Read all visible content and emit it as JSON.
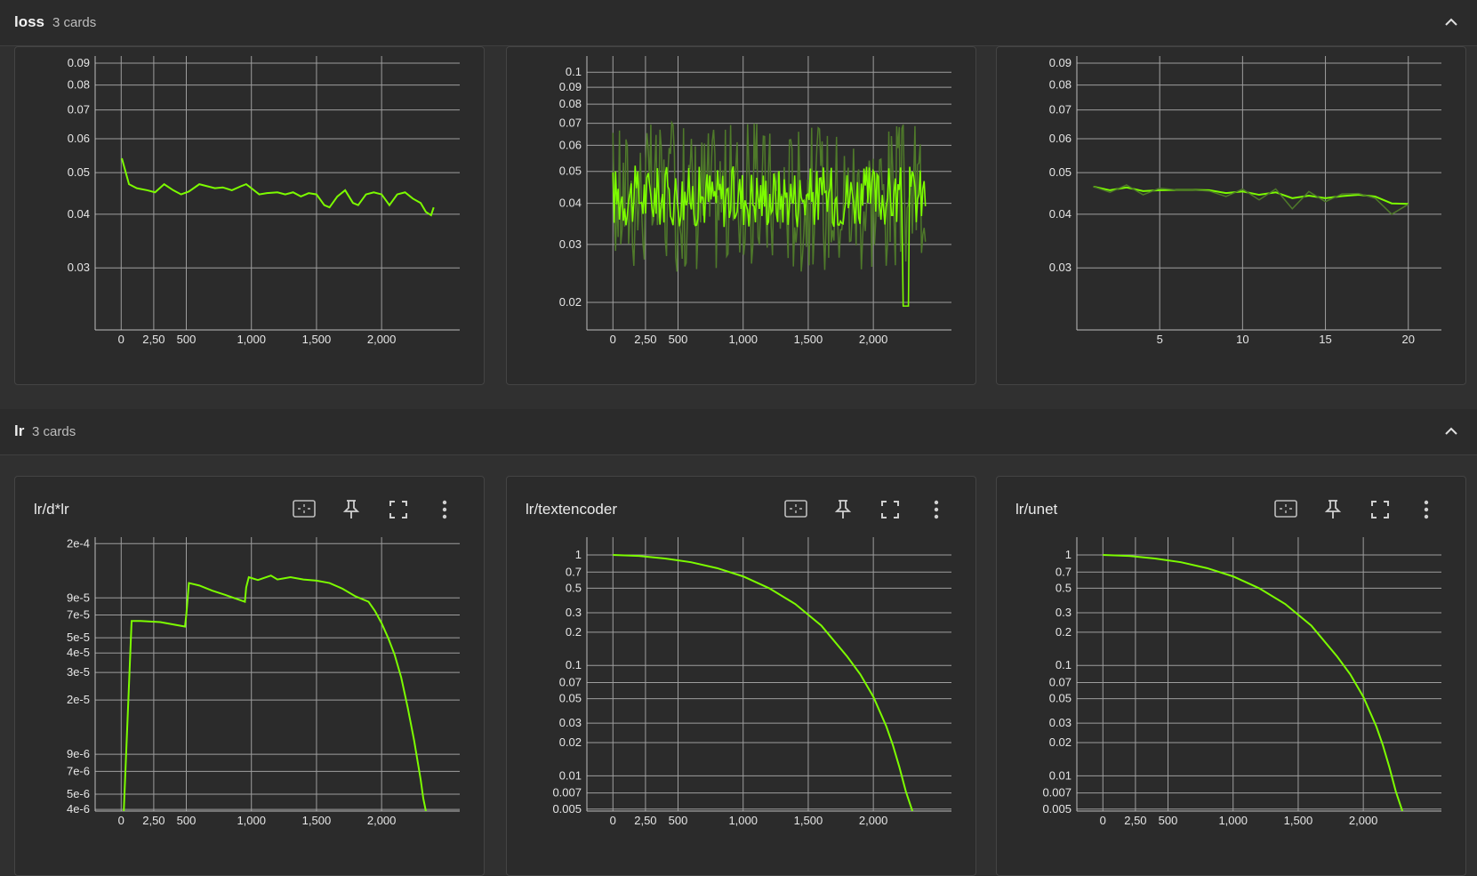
{
  "sections": [
    {
      "title": "loss",
      "count": "3 cards"
    },
    {
      "title": "lr",
      "count": "3 cards"
    }
  ],
  "icons": {
    "collapse": "chevron-up-icon",
    "fit": "fit-domain-icon",
    "pin": "pin-icon",
    "fullscreen": "fullscreen-icon",
    "more": "more-vert-icon"
  },
  "colors": {
    "series": "#7cfc00",
    "series_raw": "#4f7a2a",
    "grid": "#9e9e9e"
  },
  "chart_data": [
    {
      "type": "line",
      "title": "",
      "y_scale": "log",
      "x_ticks": [
        "0",
        "500",
        "1,000",
        "1,500",
        "2,000",
        "2,50"
      ],
      "y_ticks": [
        "0.03",
        "0.04",
        "0.05",
        "0.06",
        "0.07",
        "0.08",
        "0.09"
      ],
      "xlim": [
        -200,
        2600
      ],
      "ylim": [
        0.0215,
        0.0935
      ],
      "series": [
        {
          "x": [
            5,
            60,
            120,
            200,
            260,
            330,
            400,
            460,
            520,
            600,
            660,
            720,
            780,
            850,
            920,
            960,
            1000,
            1060,
            1120,
            1200,
            1260,
            1320,
            1380,
            1440,
            1500,
            1560,
            1600,
            1660,
            1720,
            1780,
            1820,
            1880,
            1940,
            2000,
            2060,
            2120,
            2180,
            2240,
            2300,
            2340,
            2380,
            2400
          ],
          "y": [
            0.054,
            0.047,
            0.046,
            0.0455,
            0.045,
            0.047,
            0.0455,
            0.0445,
            0.0452,
            0.047,
            0.0465,
            0.046,
            0.0462,
            0.0455,
            0.0465,
            0.047,
            0.046,
            0.0445,
            0.0448,
            0.045,
            0.0445,
            0.045,
            0.044,
            0.0448,
            0.0445,
            0.042,
            0.0415,
            0.044,
            0.0455,
            0.0425,
            0.042,
            0.0445,
            0.045,
            0.0445,
            0.042,
            0.0445,
            0.045,
            0.0435,
            0.0425,
            0.0405,
            0.0398,
            0.0415
          ]
        }
      ]
    },
    {
      "type": "line",
      "title": "",
      "y_scale": "log",
      "x_ticks": [
        "0",
        "500",
        "1,000",
        "1,500",
        "2,000",
        "2,50"
      ],
      "y_ticks": [
        "0.02",
        "0.03",
        "0.04",
        "0.05",
        "0.06",
        "0.07",
        "0.08",
        "0.09",
        "0.1"
      ],
      "xlim": [
        -200,
        2600
      ],
      "ylim": [
        0.0165,
        0.112
      ],
      "noisy": {
        "n": 240,
        "center": 0.042,
        "smooth_spread": 0.55,
        "raw_spread": 1.35,
        "dip_at": 2250,
        "dip_value": 0.0195
      },
      "series": []
    },
    {
      "type": "line",
      "title": "",
      "y_scale": "log",
      "x_ticks": [
        "5",
        "10",
        "15",
        "20"
      ],
      "x_tick_values": [
        5,
        10,
        15,
        20
      ],
      "y_ticks": [
        "0.03",
        "0.04",
        "0.05",
        "0.06",
        "0.07",
        "0.08",
        "0.09"
      ],
      "xlim": [
        0,
        22
      ],
      "ylim": [
        0.0215,
        0.0935
      ],
      "series": [
        {
          "x": [
            1,
            2,
            3,
            4,
            5,
            6,
            7,
            8,
            9,
            10,
            11,
            12,
            13,
            14,
            15,
            16,
            17,
            18,
            19,
            20
          ],
          "y": [
            0.0464,
            0.0455,
            0.0462,
            0.0453,
            0.0455,
            0.0456,
            0.0456,
            0.0455,
            0.0448,
            0.0452,
            0.0444,
            0.045,
            0.0436,
            0.0442,
            0.0436,
            0.0441,
            0.0444,
            0.044,
            0.0424,
            0.0423
          ]
        },
        {
          "raw": true,
          "x": [
            1,
            2,
            3,
            4,
            5,
            6,
            7,
            8,
            9,
            10,
            11,
            12,
            13,
            14,
            15,
            16,
            17,
            18,
            19,
            20
          ],
          "y": [
            0.0464,
            0.045,
            0.0468,
            0.0444,
            0.046,
            0.0456,
            0.0456,
            0.0453,
            0.044,
            0.0458,
            0.0432,
            0.0458,
            0.0412,
            0.0452,
            0.0428,
            0.0446,
            0.0447,
            0.0436,
            0.04,
            0.0422
          ]
        }
      ]
    },
    {
      "type": "line",
      "title": "lr/d*lr",
      "y_scale": "log",
      "x_ticks": [
        "0",
        "500",
        "1,000",
        "1,500",
        "2,000",
        "2,50"
      ],
      "y_ticks": [
        "4e-6",
        "5e-6",
        "7e-6",
        "9e-6",
        "2e-5",
        "3e-5",
        "4e-5",
        "5e-5",
        "7e-5",
        "9e-5",
        "2e-4"
      ],
      "xlim": [
        -200,
        2600
      ],
      "ylim": [
        3.9e-06,
        0.00022
      ],
      "series": [
        {
          "x": [
            20,
            80,
            150,
            300,
            490,
            500,
            520,
            600,
            700,
            800,
            950,
            960,
            980,
            1050,
            1150,
            1200,
            1300,
            1400,
            1500,
            1600,
            1700,
            1800,
            1900,
            1950,
            2000,
            2050,
            2100,
            2150,
            2200,
            2250,
            2300,
            2320,
            2340
          ],
          "y": [
            3.9e-06,
            6.4e-05,
            6.4e-05,
            6.3e-05,
            5.9e-05,
            7e-05,
            0.000112,
            0.000108,
            0.0001,
            9.4e-05,
            8.5e-05,
            0.000105,
            0.000122,
            0.000117,
            0.000125,
            0.000118,
            0.000122,
            0.000118,
            0.000116,
            0.000112,
            0.000103,
            9.2e-05,
            8.5e-05,
            7.4e-05,
            6.2e-05,
            5e-05,
            3.9e-05,
            2.8e-05,
            1.8e-05,
            1.1e-05,
            6.2e-06,
            4.7e-06,
            3.9e-06
          ]
        }
      ]
    },
    {
      "type": "line",
      "title": "lr/textencoder",
      "y_scale": "log",
      "x_ticks": [
        "0",
        "500",
        "1,000",
        "1,500",
        "2,000",
        "2,50"
      ],
      "y_ticks": [
        "0.005",
        "0.007",
        "0.01",
        "0.02",
        "0.03",
        "0.05",
        "0.07",
        "0.1",
        "0.2",
        "0.3",
        "0.5",
        "0.7",
        "1"
      ],
      "xlim": [
        -200,
        2600
      ],
      "ylim": [
        0.0048,
        1.45
      ],
      "series": [
        {
          "x": [
            0,
            200,
            400,
            600,
            800,
            1000,
            1200,
            1400,
            1600,
            1800,
            1900,
            2000,
            2100,
            2150,
            2200,
            2250,
            2300
          ],
          "y": [
            1,
            0.98,
            0.93,
            0.86,
            0.76,
            0.64,
            0.5,
            0.36,
            0.23,
            0.12,
            0.083,
            0.052,
            0.028,
            0.019,
            0.012,
            0.0072,
            0.0048
          ]
        }
      ]
    },
    {
      "type": "line",
      "title": "lr/unet",
      "y_scale": "log",
      "x_ticks": [
        "0",
        "500",
        "1,000",
        "1,500",
        "2,000",
        "2,50"
      ],
      "y_ticks": [
        "0.005",
        "0.007",
        "0.01",
        "0.02",
        "0.03",
        "0.05",
        "0.07",
        "0.1",
        "0.2",
        "0.3",
        "0.5",
        "0.7",
        "1"
      ],
      "xlim": [
        -200,
        2600
      ],
      "ylim": [
        0.0048,
        1.45
      ],
      "series": [
        {
          "x": [
            0,
            200,
            400,
            600,
            800,
            1000,
            1200,
            1400,
            1600,
            1800,
            1900,
            2000,
            2100,
            2150,
            2200,
            2250,
            2300
          ],
          "y": [
            1,
            0.98,
            0.93,
            0.86,
            0.76,
            0.64,
            0.5,
            0.36,
            0.23,
            0.12,
            0.083,
            0.052,
            0.028,
            0.019,
            0.012,
            0.0072,
            0.0048
          ]
        }
      ]
    }
  ]
}
